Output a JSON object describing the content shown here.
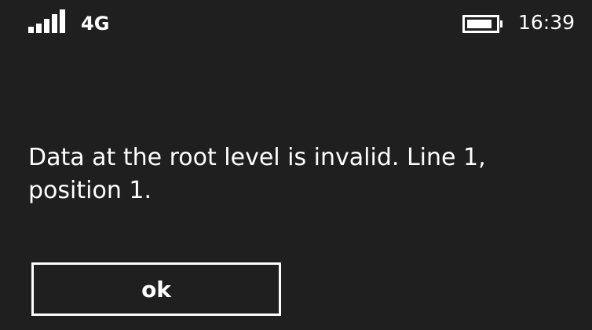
{
  "status_bar": {
    "network_type": "4G",
    "time": "16:39",
    "signal_icon": "signal-strength-icon",
    "battery_icon": "battery-icon"
  },
  "dialog": {
    "message": "Data at the root level is invalid. Line 1, position 1.",
    "ok_label": "ok"
  },
  "colors": {
    "background": "#1f1f1f",
    "foreground": "#ffffff"
  }
}
